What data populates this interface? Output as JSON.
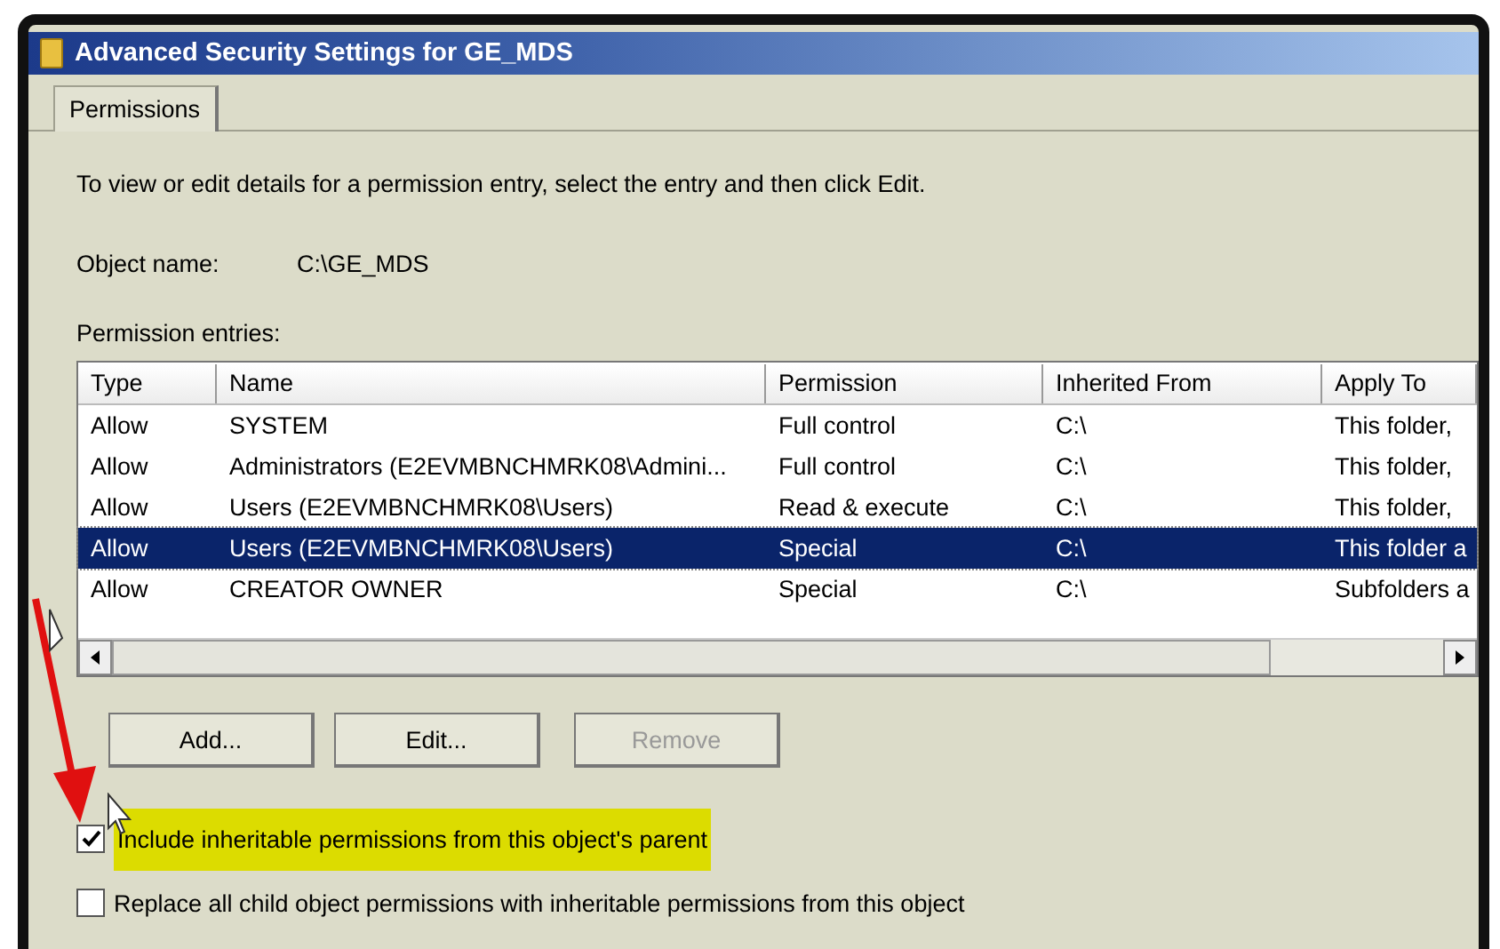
{
  "window": {
    "title": "Advanced Security Settings for GE_MDS"
  },
  "tabs": [
    {
      "label": "Permissions",
      "selected": true
    }
  ],
  "instructions": "To view or edit details for a permission entry, select the entry and then click Edit.",
  "object_name": {
    "label": "Object name:",
    "value": "C:\\GE_MDS"
  },
  "entries_label": "Permission entries:",
  "table": {
    "columns": [
      "Type",
      "Name",
      "Permission",
      "Inherited From",
      "Apply To"
    ],
    "rows": [
      {
        "cells": [
          "Allow",
          "SYSTEM",
          "Full control",
          "C:\\",
          "This folder,"
        ],
        "selected": false
      },
      {
        "cells": [
          "Allow",
          "Administrators (E2EVMBNCHMRK08\\Admini...",
          "Full control",
          "C:\\",
          "This folder,"
        ],
        "selected": false
      },
      {
        "cells": [
          "Allow",
          "Users (E2EVMBNCHMRK08\\Users)",
          "Read & execute",
          "C:\\",
          "This folder,"
        ],
        "selected": false
      },
      {
        "cells": [
          "Allow",
          "Users (E2EVMBNCHMRK08\\Users)",
          "Special",
          "C:\\",
          "This folder a"
        ],
        "selected": true
      },
      {
        "cells": [
          "Allow",
          "CREATOR OWNER",
          "Special",
          "C:\\",
          "Subfolders a"
        ],
        "selected": false
      }
    ]
  },
  "buttons": [
    {
      "label": "Add...",
      "disabled": false
    },
    {
      "label": "Edit...",
      "disabled": false
    },
    {
      "label": "Remove",
      "disabled": true
    }
  ],
  "checkboxes": [
    {
      "label": "Include inheritable permissions from this object's parent",
      "checked": true,
      "highlighted": true
    },
    {
      "label": "Replace all child object permissions with inheritable permissions from this object",
      "checked": false,
      "highlighted": false
    }
  ]
}
